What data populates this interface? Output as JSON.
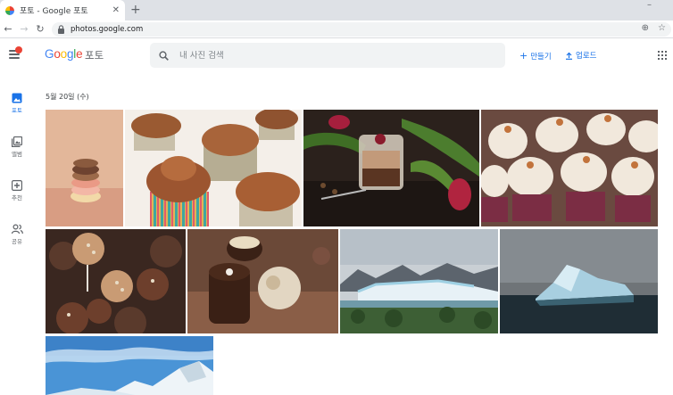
{
  "browser": {
    "tab_title": "포토 - Google 포토",
    "tab_close": "✕",
    "new_tab": "+",
    "url": "photos.google.com",
    "minimize": "–"
  },
  "app": {
    "logo_text": [
      "G",
      "o",
      "o",
      "g",
      "l",
      "e"
    ],
    "product": "포토",
    "search_placeholder": "내 사진 검색",
    "create_label": "만들기",
    "upload_label": "업로드"
  },
  "sidebar": {
    "items": [
      {
        "label": "포토",
        "icon": "photo-icon",
        "active": true
      },
      {
        "label": "앨범",
        "icon": "album-icon",
        "active": false
      },
      {
        "label": "추천",
        "icon": "recommend-icon",
        "active": false
      },
      {
        "label": "공유",
        "icon": "people-icon",
        "active": false
      }
    ]
  },
  "main": {
    "date_heading": "5월 20일 (수)",
    "photos": [
      {
        "subject": "stacked macarons"
      },
      {
        "subject": "chocolate cupcakes"
      },
      {
        "subject": "chocolate mousse dessert with tulips"
      },
      {
        "subject": "cupcakes with cream frosting"
      },
      {
        "subject": "cake pops"
      },
      {
        "subject": "chocolate truffles"
      },
      {
        "subject": "glacier and mountains"
      },
      {
        "subject": "iceberg in lake"
      },
      {
        "subject": "snowy mountain under blue sky"
      }
    ]
  },
  "colors": {
    "accent": "#1a73e8",
    "notification": "#ea4335"
  }
}
